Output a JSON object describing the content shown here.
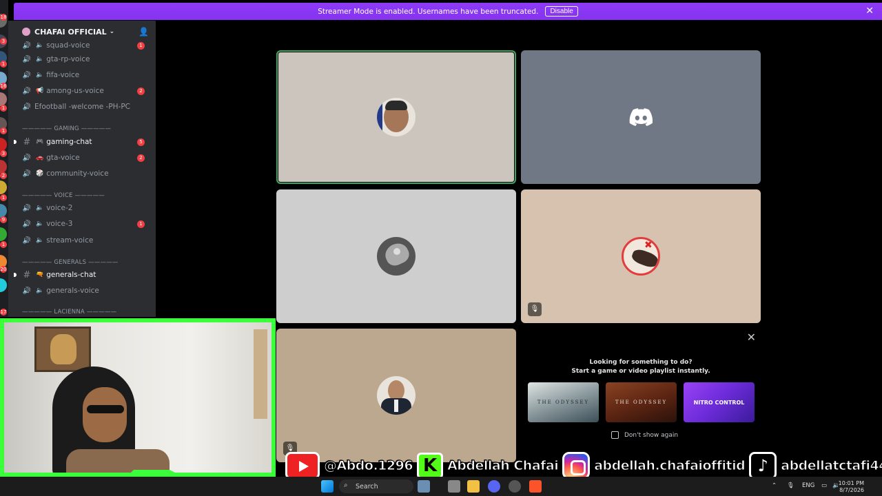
{
  "banner": {
    "message": "Streamer Mode is enabled. Usernames have been truncated.",
    "disable_label": "Disable"
  },
  "server": {
    "name": "CHAFAI OFFICIAL"
  },
  "sidebar": {
    "channels": [
      {
        "label": "squad-voice",
        "badge": "1"
      },
      {
        "label": "gta-rp-voice"
      },
      {
        "label": "fifa-voice"
      },
      {
        "label": "among-us-voice",
        "badge": "2"
      },
      {
        "label": "Efootball -welcome -PH-PC"
      },
      {
        "label": "gaming-chat",
        "badge": "5"
      },
      {
        "label": "gta-voice",
        "badge": "2"
      },
      {
        "label": "community-voice"
      },
      {
        "label": "voice-2"
      },
      {
        "label": "voice-3",
        "badge": "1"
      },
      {
        "label": "stream-voice"
      },
      {
        "label": "generals-chat"
      },
      {
        "label": "generals-voice"
      }
    ],
    "categories": [
      "————— GAMING —————",
      "————— VOICE —————",
      "————— GENERALS —————",
      "————— LACIENNA —————"
    ],
    "rail_badges": [
      "18",
      "3",
      "1",
      "16",
      "1",
      "1",
      "3",
      "2",
      "1",
      "9",
      "1",
      "20",
      "17"
    ]
  },
  "voice": {
    "colors": {
      "tile1": "#cbc5bd",
      "tile2": "#707886",
      "tile3": "#cecece",
      "tile4": "#d6c2ae",
      "tile5": "#bca88e",
      "speaking": "#3ba55d"
    },
    "icons": [
      "discord-logo-icon",
      "mic-muted-icon"
    ]
  },
  "activity": {
    "title_line1": "Looking for something to do?",
    "title_line2": "Start a game or video playlist instantly.",
    "cards": [
      "THE ODYSSEY",
      "THE ODYSSEY",
      "NITRO CONTROL"
    ],
    "dont_show": "Don't show again"
  },
  "social": {
    "youtube": "@Abdo.1296",
    "kick": "Abdellah Chafai",
    "kick_letter": "K",
    "instagram": "abdellah.chafaioffitid",
    "tiktok": "abdellatctafi44"
  },
  "taskbar": {
    "search": "Search",
    "lang": "ENG",
    "time": "10:01 PM",
    "date": "8/7/2026"
  }
}
